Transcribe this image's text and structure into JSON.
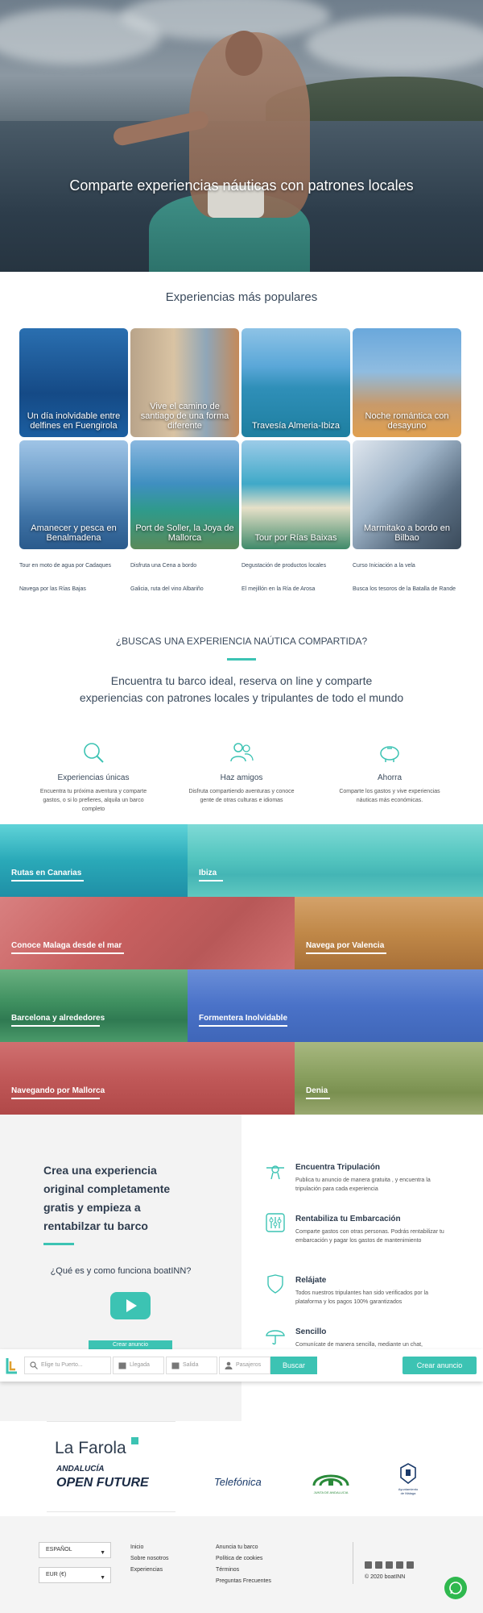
{
  "hero": {
    "title": "Comparte experiencias náuticas con patrones locales"
  },
  "popular": {
    "title": "Experiencias más populares",
    "tiles": [
      {
        "label": "Un día inolvidable entre delfines en Fuengirola"
      },
      {
        "label": "Vive el camino de santiago de una forma diferente"
      },
      {
        "label": "Travesía Almeria-Ibiza"
      },
      {
        "label": "Noche romántica con desayuno"
      },
      {
        "label": "Amanecer y pesca en Benalmadena"
      },
      {
        "label": "Port de Soller, la Joya de Mallorca"
      },
      {
        "label": "Tour por Rías Baixas"
      },
      {
        "label": "Marmitako a bordo en Bilbao"
      }
    ],
    "links": [
      "Tour en moto de agua por Cadaques",
      "Disfruta una Cena a bordo",
      "Degustación de productos locales",
      "Curso Iniciación a la vela",
      "Navega por las Rías Bajas",
      "Galicia, ruta del vino Albariño",
      "El mejillón en la Ría de Arosa",
      "Busca los tesoros de la Batalla de Rande"
    ]
  },
  "shared": {
    "question": "¿BUSCAS UNA EXPERIENCIA NAÚTICA COMPARTIDA?",
    "line1": "Encuentra tu barco ideal, reserva on line y comparte",
    "line2": "experiencias con patrones locales y tripulantes de todo el mundo"
  },
  "features": [
    {
      "title": "Experiencias únicas",
      "desc": "Encuentra tu próxima aventura y comparte gastos, o si lo prefieres, alquila un barco completo",
      "icon": "search-icon"
    },
    {
      "title": "Haz amigos",
      "desc": "Disfruta compartiendo aventuras y conoce gente de otras culturas e idiomas",
      "icon": "people-icon"
    },
    {
      "title": "Ahorra",
      "desc": "Comparte los gastos y vive experiencias náuticas más económicas.",
      "icon": "piggy-bank-icon"
    }
  ],
  "destinations": [
    {
      "label": "Rutas en Canarias",
      "color": "#3cc3c9"
    },
    {
      "label": "Ibiza",
      "color": "#5fd0c8"
    },
    {
      "label": "Conoce Malaga desde el mar",
      "color": "#d66a6a"
    },
    {
      "label": "Navega por Valencia",
      "color": "#c98a4a"
    },
    {
      "label": "Barcelona y alrededores",
      "color": "#4aa268"
    },
    {
      "label": "Formentera Inolvidable",
      "color": "#5a7fd0"
    },
    {
      "label": "Navegando por Mallorca",
      "color": "#c95a5a"
    },
    {
      "label": "Denia",
      "color": "#8aa060"
    }
  ],
  "create": {
    "heading_l1": "Crea una experiencia",
    "heading_l2": "original completamente",
    "heading_l3": "gratis y empieza a",
    "heading_l4": "rentabilzar tu barco",
    "how": "¿Qué es y como funciona boatINN?",
    "button": "Crear anuncio"
  },
  "benefits": [
    {
      "title": "Encuentra Tripulación",
      "desc": "Publica tu anuncio de manera gratuita , y encuentra la tripulación para cada experiencia",
      "icon": "helm-icon"
    },
    {
      "title": "Rentabiliza tu Embarcación",
      "desc": "Comparte gastos con otras personas. Podrás rentabilizar tu embarcación y pagar los gastos de mantenimiento",
      "icon": "sliders-icon"
    },
    {
      "title": "Relájate",
      "desc": "Todos nuestros tripulantes han sido verificados por la plataforma y los pagos 100% garantizados",
      "icon": "shield-icon"
    },
    {
      "title": "Sencillo",
      "desc": "Comunícate de manera sencilla, mediante un chat,",
      "icon": "umbrella-icon"
    }
  ],
  "search": {
    "port_placeholder": "Elige tu Puerto...",
    "arrival_placeholder": "Llegada",
    "departure_placeholder": "Salida",
    "passengers_placeholder": "Pasajeros",
    "search_button": "Buscar",
    "create_button": "Crear anuncio"
  },
  "partners": {
    "lafarola": "La Farola",
    "andalucia_l1": "ANDALUCÍA",
    "andalucia_l2": "OPEN FUTURE",
    "telefonica": "Telefónica",
    "junta": "JUNTA DE ANDALUCIA",
    "ayto_l1": "Ayuntamiento",
    "ayto_l2": "de Málaga"
  },
  "footer": {
    "language": "ESPAÑOL",
    "currency": "EUR (€)",
    "col1": [
      "Inicio",
      "Sobre nosotros",
      "Experiencias"
    ],
    "col2": [
      "Anuncia tu barco",
      "Política de cookies",
      "Términos",
      "Preguntas Frecuentes"
    ],
    "copyright": "© 2020 boatINN"
  },
  "colors": {
    "accent": "#3cc3b3",
    "title": "#3a4a5c",
    "whatsapp": "#2fb84e"
  }
}
